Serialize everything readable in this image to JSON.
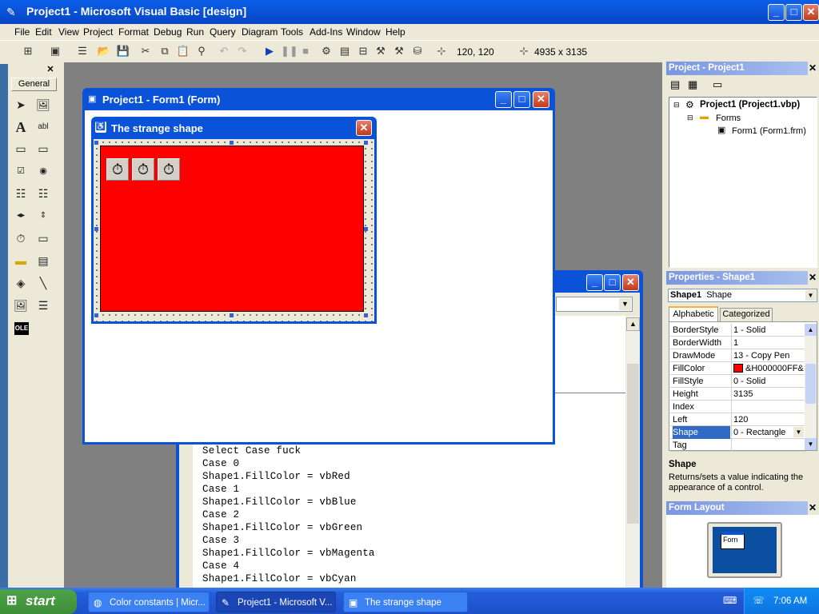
{
  "window": {
    "title": "Project1 - Microsoft Visual Basic [design]"
  },
  "menu": [
    "File",
    "Edit",
    "View",
    "Project",
    "Format",
    "Debug",
    "Run",
    "Query",
    "Diagram",
    "Tools",
    "Add-Ins",
    "Window",
    "Help"
  ],
  "toolbar": {
    "position": "120, 120",
    "size": "4935 x 3135"
  },
  "toolbox": {
    "tab": "General"
  },
  "form_window": {
    "title": "Project1 - Form1 (Form)"
  },
  "designer_form": {
    "caption": "The strange shape",
    "shape_color": "#ff0000",
    "timer_count": 3
  },
  "code": {
    "lines": [
      "Select Case fuck",
      "Case 0",
      "Shape1.FillColor = vbRed",
      "Case 1",
      "Shape1.FillColor = vbBlue",
      "Case 2",
      "Shape1.FillColor = vbGreen",
      "Case 3",
      "Shape1.FillColor = vbMagenta",
      "Case 4",
      "Shape1.FillColor = vbCyan"
    ]
  },
  "project_panel": {
    "title": "Project - Project1",
    "root": "Project1 (Project1.vbp)",
    "folder": "Forms",
    "item": "Form1 (Form1.frm)"
  },
  "properties_panel": {
    "title": "Properties - Shape1",
    "object_name": "Shape1",
    "object_type": "Shape",
    "tabs": [
      "Alphabetic",
      "Categorized"
    ],
    "rows": [
      {
        "k": "BorderStyle",
        "v": "1 - Solid"
      },
      {
        "k": "BorderWidth",
        "v": "1"
      },
      {
        "k": "DrawMode",
        "v": "13 - Copy Pen"
      },
      {
        "k": "FillColor",
        "v": "&H000000FF&"
      },
      {
        "k": "FillStyle",
        "v": "0 - Solid"
      },
      {
        "k": "Height",
        "v": "3135"
      },
      {
        "k": "Index",
        "v": ""
      },
      {
        "k": "Left",
        "v": "120"
      },
      {
        "k": "Shape",
        "v": "0 - Rectangle"
      },
      {
        "k": "Tag",
        "v": ""
      }
    ],
    "selected_row": "Shape",
    "desc_title": "Shape",
    "desc_text": "Returns/sets a value indicating the appearance of a control."
  },
  "form_layout": {
    "title": "Form Layout",
    "mini_label": "Forn"
  },
  "taskbar": {
    "start": "start",
    "items": [
      "Color constants | Micr...",
      "Project1 - Microsoft V...",
      "The strange shape"
    ],
    "clock": "7:06 AM"
  },
  "colors": {
    "xp_blue": "#0a53d8",
    "shape_fill": "#ff0000",
    "ide_bg": "#808080"
  }
}
